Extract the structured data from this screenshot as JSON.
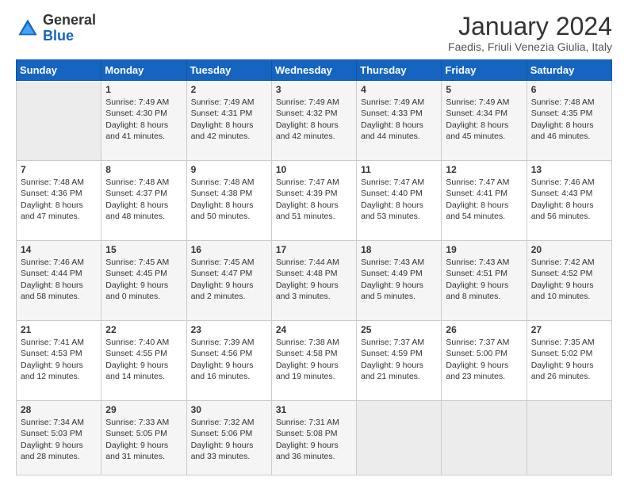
{
  "logo": {
    "general": "General",
    "blue": "Blue"
  },
  "header": {
    "month": "January 2024",
    "location": "Faedis, Friuli Venezia Giulia, Italy"
  },
  "weekdays": [
    "Sunday",
    "Monday",
    "Tuesday",
    "Wednesday",
    "Thursday",
    "Friday",
    "Saturday"
  ],
  "weeks": [
    [
      {
        "day": null,
        "lines": []
      },
      {
        "day": "1",
        "lines": [
          "Sunrise: 7:49 AM",
          "Sunset: 4:30 PM",
          "Daylight: 8 hours",
          "and 41 minutes."
        ]
      },
      {
        "day": "2",
        "lines": [
          "Sunrise: 7:49 AM",
          "Sunset: 4:31 PM",
          "Daylight: 8 hours",
          "and 42 minutes."
        ]
      },
      {
        "day": "3",
        "lines": [
          "Sunrise: 7:49 AM",
          "Sunset: 4:32 PM",
          "Daylight: 8 hours",
          "and 42 minutes."
        ]
      },
      {
        "day": "4",
        "lines": [
          "Sunrise: 7:49 AM",
          "Sunset: 4:33 PM",
          "Daylight: 8 hours",
          "and 44 minutes."
        ]
      },
      {
        "day": "5",
        "lines": [
          "Sunrise: 7:49 AM",
          "Sunset: 4:34 PM",
          "Daylight: 8 hours",
          "and 45 minutes."
        ]
      },
      {
        "day": "6",
        "lines": [
          "Sunrise: 7:48 AM",
          "Sunset: 4:35 PM",
          "Daylight: 8 hours",
          "and 46 minutes."
        ]
      }
    ],
    [
      {
        "day": "7",
        "lines": [
          "Sunrise: 7:48 AM",
          "Sunset: 4:36 PM",
          "Daylight: 8 hours",
          "and 47 minutes."
        ]
      },
      {
        "day": "8",
        "lines": [
          "Sunrise: 7:48 AM",
          "Sunset: 4:37 PM",
          "Daylight: 8 hours",
          "and 48 minutes."
        ]
      },
      {
        "day": "9",
        "lines": [
          "Sunrise: 7:48 AM",
          "Sunset: 4:38 PM",
          "Daylight: 8 hours",
          "and 50 minutes."
        ]
      },
      {
        "day": "10",
        "lines": [
          "Sunrise: 7:47 AM",
          "Sunset: 4:39 PM",
          "Daylight: 8 hours",
          "and 51 minutes."
        ]
      },
      {
        "day": "11",
        "lines": [
          "Sunrise: 7:47 AM",
          "Sunset: 4:40 PM",
          "Daylight: 8 hours",
          "and 53 minutes."
        ]
      },
      {
        "day": "12",
        "lines": [
          "Sunrise: 7:47 AM",
          "Sunset: 4:41 PM",
          "Daylight: 8 hours",
          "and 54 minutes."
        ]
      },
      {
        "day": "13",
        "lines": [
          "Sunrise: 7:46 AM",
          "Sunset: 4:43 PM",
          "Daylight: 8 hours",
          "and 56 minutes."
        ]
      }
    ],
    [
      {
        "day": "14",
        "lines": [
          "Sunrise: 7:46 AM",
          "Sunset: 4:44 PM",
          "Daylight: 8 hours",
          "and 58 minutes."
        ]
      },
      {
        "day": "15",
        "lines": [
          "Sunrise: 7:45 AM",
          "Sunset: 4:45 PM",
          "Daylight: 9 hours",
          "and 0 minutes."
        ]
      },
      {
        "day": "16",
        "lines": [
          "Sunrise: 7:45 AM",
          "Sunset: 4:47 PM",
          "Daylight: 9 hours",
          "and 2 minutes."
        ]
      },
      {
        "day": "17",
        "lines": [
          "Sunrise: 7:44 AM",
          "Sunset: 4:48 PM",
          "Daylight: 9 hours",
          "and 3 minutes."
        ]
      },
      {
        "day": "18",
        "lines": [
          "Sunrise: 7:43 AM",
          "Sunset: 4:49 PM",
          "Daylight: 9 hours",
          "and 5 minutes."
        ]
      },
      {
        "day": "19",
        "lines": [
          "Sunrise: 7:43 AM",
          "Sunset: 4:51 PM",
          "Daylight: 9 hours",
          "and 8 minutes."
        ]
      },
      {
        "day": "20",
        "lines": [
          "Sunrise: 7:42 AM",
          "Sunset: 4:52 PM",
          "Daylight: 9 hours",
          "and 10 minutes."
        ]
      }
    ],
    [
      {
        "day": "21",
        "lines": [
          "Sunrise: 7:41 AM",
          "Sunset: 4:53 PM",
          "Daylight: 9 hours",
          "and 12 minutes."
        ]
      },
      {
        "day": "22",
        "lines": [
          "Sunrise: 7:40 AM",
          "Sunset: 4:55 PM",
          "Daylight: 9 hours",
          "and 14 minutes."
        ]
      },
      {
        "day": "23",
        "lines": [
          "Sunrise: 7:39 AM",
          "Sunset: 4:56 PM",
          "Daylight: 9 hours",
          "and 16 minutes."
        ]
      },
      {
        "day": "24",
        "lines": [
          "Sunrise: 7:38 AM",
          "Sunset: 4:58 PM",
          "Daylight: 9 hours",
          "and 19 minutes."
        ]
      },
      {
        "day": "25",
        "lines": [
          "Sunrise: 7:37 AM",
          "Sunset: 4:59 PM",
          "Daylight: 9 hours",
          "and 21 minutes."
        ]
      },
      {
        "day": "26",
        "lines": [
          "Sunrise: 7:37 AM",
          "Sunset: 5:00 PM",
          "Daylight: 9 hours",
          "and 23 minutes."
        ]
      },
      {
        "day": "27",
        "lines": [
          "Sunrise: 7:35 AM",
          "Sunset: 5:02 PM",
          "Daylight: 9 hours",
          "and 26 minutes."
        ]
      }
    ],
    [
      {
        "day": "28",
        "lines": [
          "Sunrise: 7:34 AM",
          "Sunset: 5:03 PM",
          "Daylight: 9 hours",
          "and 28 minutes."
        ]
      },
      {
        "day": "29",
        "lines": [
          "Sunrise: 7:33 AM",
          "Sunset: 5:05 PM",
          "Daylight: 9 hours",
          "and 31 minutes."
        ]
      },
      {
        "day": "30",
        "lines": [
          "Sunrise: 7:32 AM",
          "Sunset: 5:06 PM",
          "Daylight: 9 hours",
          "and 33 minutes."
        ]
      },
      {
        "day": "31",
        "lines": [
          "Sunrise: 7:31 AM",
          "Sunset: 5:08 PM",
          "Daylight: 9 hours",
          "and 36 minutes."
        ]
      },
      {
        "day": null,
        "lines": []
      },
      {
        "day": null,
        "lines": []
      },
      {
        "day": null,
        "lines": []
      }
    ]
  ]
}
